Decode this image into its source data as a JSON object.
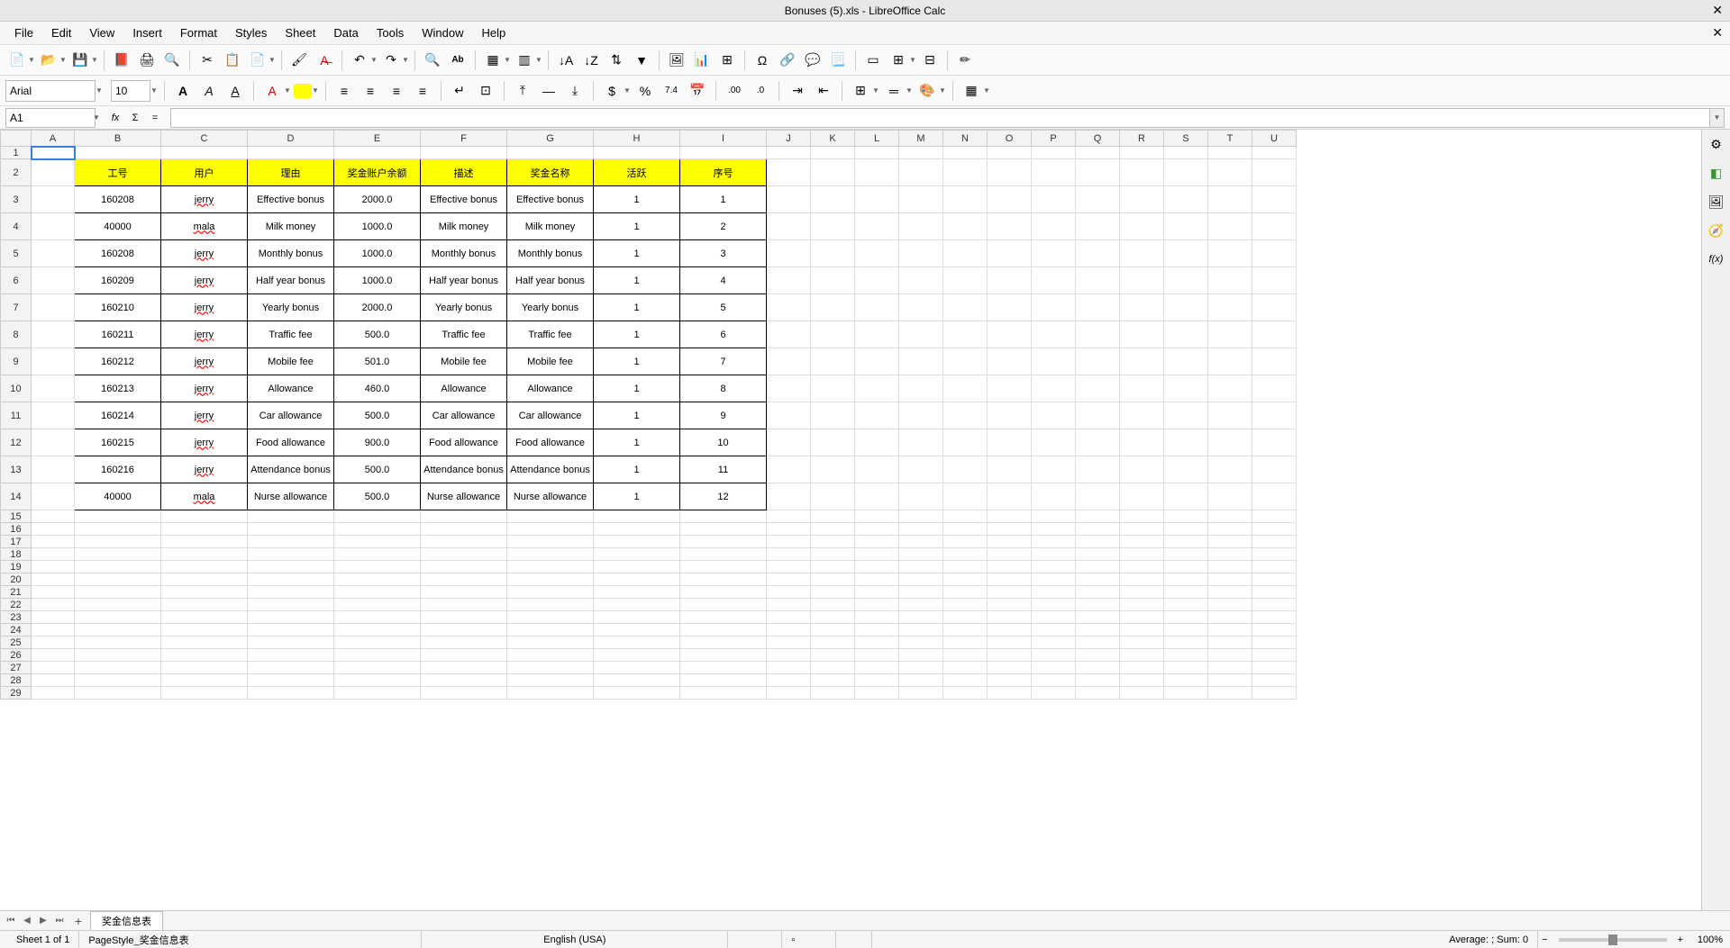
{
  "title": "Bonuses (5).xls - LibreOffice Calc",
  "menu": [
    "File",
    "Edit",
    "View",
    "Insert",
    "Format",
    "Styles",
    "Sheet",
    "Data",
    "Tools",
    "Window",
    "Help"
  ],
  "font": {
    "name": "Arial",
    "size": "10"
  },
  "cellref": "A1",
  "formula": "",
  "columns": [
    "A",
    "B",
    "C",
    "D",
    "E",
    "F",
    "G",
    "H",
    "I",
    "J",
    "K",
    "L",
    "M",
    "N",
    "O",
    "P",
    "Q",
    "R",
    "S",
    "T",
    "U"
  ],
  "headers": [
    "工号",
    "用户",
    "理由",
    "奖金账户余额",
    "描述",
    "奖金名称",
    "活跃",
    "序号"
  ],
  "rows": [
    {
      "id": "160208",
      "user": "jerry",
      "reason": "Effective bonus",
      "balance": "2000.0",
      "desc": "Effective bonus",
      "bname": "Effective bonus",
      "active": "1",
      "seq": "1",
      "spell": true
    },
    {
      "id": "40000",
      "user": "mala",
      "reason": "Milk money",
      "balance": "1000.0",
      "desc": "Milk money",
      "bname": "Milk money",
      "active": "1",
      "seq": "2",
      "spell": true
    },
    {
      "id": "160208",
      "user": "jerry",
      "reason": "Monthly bonus",
      "balance": "1000.0",
      "desc": "Monthly bonus",
      "bname": "Monthly bonus",
      "active": "1",
      "seq": "3",
      "spell": true
    },
    {
      "id": "160209",
      "user": "jerry",
      "reason": "Half year bonus",
      "balance": "1000.0",
      "desc": "Half year bonus",
      "bname": "Half year bonus",
      "active": "1",
      "seq": "4",
      "spell": true
    },
    {
      "id": "160210",
      "user": "jerry",
      "reason": "Yearly bonus",
      "balance": "2000.0",
      "desc": "Yearly bonus",
      "bname": "Yearly bonus",
      "active": "1",
      "seq": "5",
      "spell": true
    },
    {
      "id": "160211",
      "user": "jerry",
      "reason": "Traffic fee",
      "balance": "500.0",
      "desc": "Traffic fee",
      "bname": "Traffic fee",
      "active": "1",
      "seq": "6",
      "spell": true
    },
    {
      "id": "160212",
      "user": "jerry",
      "reason": "Mobile fee",
      "balance": "501.0",
      "desc": "Mobile fee",
      "bname": "Mobile fee",
      "active": "1",
      "seq": "7",
      "spell": true
    },
    {
      "id": "160213",
      "user": "jerry",
      "reason": "Allowance",
      "balance": "460.0",
      "desc": "Allowance",
      "bname": "Allowance",
      "active": "1",
      "seq": "8",
      "spell": true
    },
    {
      "id": "160214",
      "user": "jerry",
      "reason": "Car allowance",
      "balance": "500.0",
      "desc": "Car allowance",
      "bname": "Car allowance",
      "active": "1",
      "seq": "9",
      "spell": true
    },
    {
      "id": "160215",
      "user": "jerry",
      "reason": "Food allowance",
      "balance": "900.0",
      "desc": "Food allowance",
      "bname": "Food allowance",
      "active": "1",
      "seq": "10",
      "spell": true
    },
    {
      "id": "160216",
      "user": "jerry",
      "reason": "Attendance bonus",
      "balance": "500.0",
      "desc": "Attendance bonus",
      "bname": "Attendance bonus",
      "active": "1",
      "seq": "11",
      "spell": true
    },
    {
      "id": "40000",
      "user": "mala",
      "reason": "Nurse allowance",
      "balance": "500.0",
      "desc": "Nurse allowance",
      "bname": "Nurse allowance",
      "active": "1",
      "seq": "12",
      "spell": true
    }
  ],
  "sheet_tab": "奖金信息表",
  "status": {
    "sheet": "Sheet 1 of 1",
    "pagestyle": "PageStyle_奖金信息表",
    "lang": "English (USA)",
    "summary": "Average: ; Sum: 0",
    "zoom": "100%"
  },
  "chart_data": {
    "type": "table",
    "title": "奖金信息表 (Bonus Information)",
    "columns": [
      "工号",
      "用户",
      "理由",
      "奖金账户余额",
      "描述",
      "奖金名称",
      "活跃",
      "序号"
    ],
    "data": [
      [
        "160208",
        "jerry",
        "Effective bonus",
        2000.0,
        "Effective bonus",
        "Effective bonus",
        1,
        1
      ],
      [
        "40000",
        "mala",
        "Milk money",
        1000.0,
        "Milk money",
        "Milk money",
        1,
        2
      ],
      [
        "160208",
        "jerry",
        "Monthly bonus",
        1000.0,
        "Monthly bonus",
        "Monthly bonus",
        1,
        3
      ],
      [
        "160209",
        "jerry",
        "Half year bonus",
        1000.0,
        "Half year bonus",
        "Half year bonus",
        1,
        4
      ],
      [
        "160210",
        "jerry",
        "Yearly bonus",
        2000.0,
        "Yearly bonus",
        "Yearly bonus",
        1,
        5
      ],
      [
        "160211",
        "jerry",
        "Traffic fee",
        500.0,
        "Traffic fee",
        "Traffic fee",
        1,
        6
      ],
      [
        "160212",
        "jerry",
        "Mobile fee",
        501.0,
        "Mobile fee",
        "Mobile fee",
        1,
        7
      ],
      [
        "160213",
        "jerry",
        "Allowance",
        460.0,
        "Allowance",
        "Allowance",
        1,
        8
      ],
      [
        "160214",
        "jerry",
        "Car allowance",
        500.0,
        "Car allowance",
        "Car allowance",
        1,
        9
      ],
      [
        "160215",
        "jerry",
        "Food allowance",
        900.0,
        "Food allowance",
        "Food allowance",
        1,
        10
      ],
      [
        "160216",
        "jerry",
        "Attendance bonus",
        500.0,
        "Attendance bonus",
        "Attendance bonus",
        1,
        11
      ],
      [
        "40000",
        "mala",
        "Nurse allowance",
        500.0,
        "Nurse allowance",
        "Nurse allowance",
        1,
        12
      ]
    ]
  }
}
